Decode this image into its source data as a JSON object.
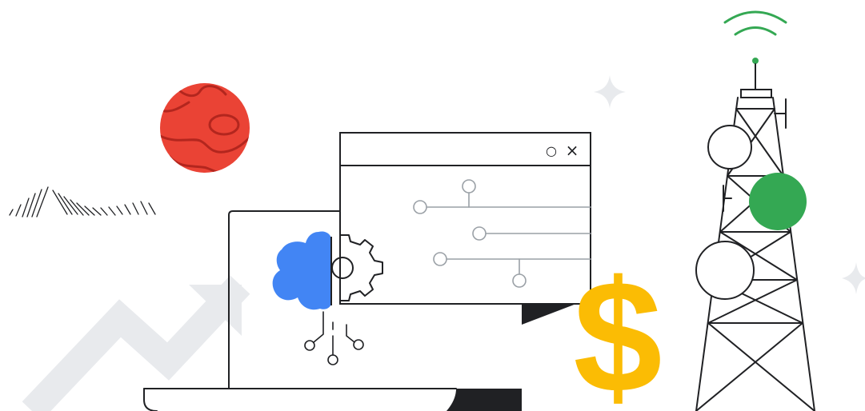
{
  "colors": {
    "ink": "#202124",
    "planet_red": "#ea4335",
    "planet_stripe": "#b3261e",
    "cloud_blue": "#4285f4",
    "signal_green": "#34a853",
    "dollar_yellow": "#fbbc04",
    "arrow_grey": "#e8eaed",
    "circuit_grey": "#9aa0a6"
  },
  "icons": {
    "planet": "planet-icon",
    "hatch": "hatch-lines-decoration",
    "sparkle": "sparkle-icon",
    "trend_arrow": "trend-up-arrow-icon",
    "laptop": "laptop-icon",
    "browser_window": "browser-window-icon",
    "cloud": "cloud-icon",
    "gear": "gear-icon",
    "dollar": "dollar-sign-icon",
    "cell_tower": "cell-tower-icon",
    "wifi_signal": "wifi-signal-icon"
  },
  "window": {
    "control_circle_glyph": "○",
    "control_close_glyph": "×"
  },
  "dollar_symbol": "$"
}
